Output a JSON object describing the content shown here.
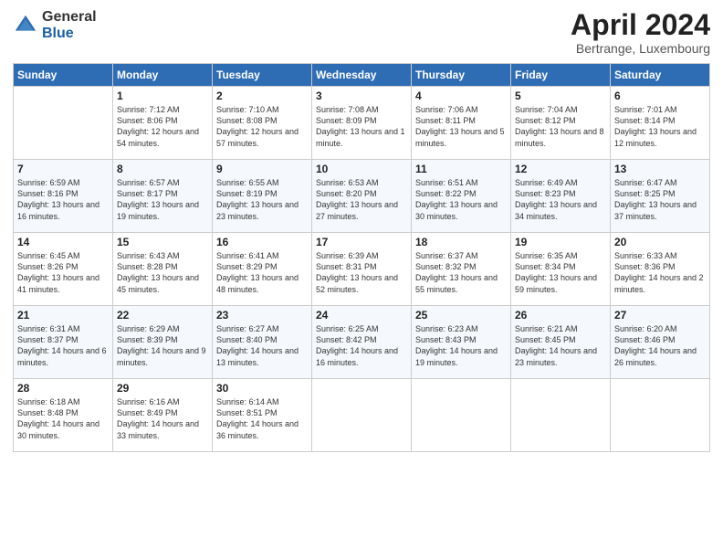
{
  "logo": {
    "general": "General",
    "blue": "Blue"
  },
  "title": "April 2024",
  "location": "Bertrange, Luxembourg",
  "headers": [
    "Sunday",
    "Monday",
    "Tuesday",
    "Wednesday",
    "Thursday",
    "Friday",
    "Saturday"
  ],
  "weeks": [
    [
      {
        "day": "",
        "sunrise": "",
        "sunset": "",
        "daylight": ""
      },
      {
        "day": "1",
        "sunrise": "Sunrise: 7:12 AM",
        "sunset": "Sunset: 8:06 PM",
        "daylight": "Daylight: 12 hours and 54 minutes."
      },
      {
        "day": "2",
        "sunrise": "Sunrise: 7:10 AM",
        "sunset": "Sunset: 8:08 PM",
        "daylight": "Daylight: 12 hours and 57 minutes."
      },
      {
        "day": "3",
        "sunrise": "Sunrise: 7:08 AM",
        "sunset": "Sunset: 8:09 PM",
        "daylight": "Daylight: 13 hours and 1 minute."
      },
      {
        "day": "4",
        "sunrise": "Sunrise: 7:06 AM",
        "sunset": "Sunset: 8:11 PM",
        "daylight": "Daylight: 13 hours and 5 minutes."
      },
      {
        "day": "5",
        "sunrise": "Sunrise: 7:04 AM",
        "sunset": "Sunset: 8:12 PM",
        "daylight": "Daylight: 13 hours and 8 minutes."
      },
      {
        "day": "6",
        "sunrise": "Sunrise: 7:01 AM",
        "sunset": "Sunset: 8:14 PM",
        "daylight": "Daylight: 13 hours and 12 minutes."
      }
    ],
    [
      {
        "day": "7",
        "sunrise": "Sunrise: 6:59 AM",
        "sunset": "Sunset: 8:16 PM",
        "daylight": "Daylight: 13 hours and 16 minutes."
      },
      {
        "day": "8",
        "sunrise": "Sunrise: 6:57 AM",
        "sunset": "Sunset: 8:17 PM",
        "daylight": "Daylight: 13 hours and 19 minutes."
      },
      {
        "day": "9",
        "sunrise": "Sunrise: 6:55 AM",
        "sunset": "Sunset: 8:19 PM",
        "daylight": "Daylight: 13 hours and 23 minutes."
      },
      {
        "day": "10",
        "sunrise": "Sunrise: 6:53 AM",
        "sunset": "Sunset: 8:20 PM",
        "daylight": "Daylight: 13 hours and 27 minutes."
      },
      {
        "day": "11",
        "sunrise": "Sunrise: 6:51 AM",
        "sunset": "Sunset: 8:22 PM",
        "daylight": "Daylight: 13 hours and 30 minutes."
      },
      {
        "day": "12",
        "sunrise": "Sunrise: 6:49 AM",
        "sunset": "Sunset: 8:23 PM",
        "daylight": "Daylight: 13 hours and 34 minutes."
      },
      {
        "day": "13",
        "sunrise": "Sunrise: 6:47 AM",
        "sunset": "Sunset: 8:25 PM",
        "daylight": "Daylight: 13 hours and 37 minutes."
      }
    ],
    [
      {
        "day": "14",
        "sunrise": "Sunrise: 6:45 AM",
        "sunset": "Sunset: 8:26 PM",
        "daylight": "Daylight: 13 hours and 41 minutes."
      },
      {
        "day": "15",
        "sunrise": "Sunrise: 6:43 AM",
        "sunset": "Sunset: 8:28 PM",
        "daylight": "Daylight: 13 hours and 45 minutes."
      },
      {
        "day": "16",
        "sunrise": "Sunrise: 6:41 AM",
        "sunset": "Sunset: 8:29 PM",
        "daylight": "Daylight: 13 hours and 48 minutes."
      },
      {
        "day": "17",
        "sunrise": "Sunrise: 6:39 AM",
        "sunset": "Sunset: 8:31 PM",
        "daylight": "Daylight: 13 hours and 52 minutes."
      },
      {
        "day": "18",
        "sunrise": "Sunrise: 6:37 AM",
        "sunset": "Sunset: 8:32 PM",
        "daylight": "Daylight: 13 hours and 55 minutes."
      },
      {
        "day": "19",
        "sunrise": "Sunrise: 6:35 AM",
        "sunset": "Sunset: 8:34 PM",
        "daylight": "Daylight: 13 hours and 59 minutes."
      },
      {
        "day": "20",
        "sunrise": "Sunrise: 6:33 AM",
        "sunset": "Sunset: 8:36 PM",
        "daylight": "Daylight: 14 hours and 2 minutes."
      }
    ],
    [
      {
        "day": "21",
        "sunrise": "Sunrise: 6:31 AM",
        "sunset": "Sunset: 8:37 PM",
        "daylight": "Daylight: 14 hours and 6 minutes."
      },
      {
        "day": "22",
        "sunrise": "Sunrise: 6:29 AM",
        "sunset": "Sunset: 8:39 PM",
        "daylight": "Daylight: 14 hours and 9 minutes."
      },
      {
        "day": "23",
        "sunrise": "Sunrise: 6:27 AM",
        "sunset": "Sunset: 8:40 PM",
        "daylight": "Daylight: 14 hours and 13 minutes."
      },
      {
        "day": "24",
        "sunrise": "Sunrise: 6:25 AM",
        "sunset": "Sunset: 8:42 PM",
        "daylight": "Daylight: 14 hours and 16 minutes."
      },
      {
        "day": "25",
        "sunrise": "Sunrise: 6:23 AM",
        "sunset": "Sunset: 8:43 PM",
        "daylight": "Daylight: 14 hours and 19 minutes."
      },
      {
        "day": "26",
        "sunrise": "Sunrise: 6:21 AM",
        "sunset": "Sunset: 8:45 PM",
        "daylight": "Daylight: 14 hours and 23 minutes."
      },
      {
        "day": "27",
        "sunrise": "Sunrise: 6:20 AM",
        "sunset": "Sunset: 8:46 PM",
        "daylight": "Daylight: 14 hours and 26 minutes."
      }
    ],
    [
      {
        "day": "28",
        "sunrise": "Sunrise: 6:18 AM",
        "sunset": "Sunset: 8:48 PM",
        "daylight": "Daylight: 14 hours and 30 minutes."
      },
      {
        "day": "29",
        "sunrise": "Sunrise: 6:16 AM",
        "sunset": "Sunset: 8:49 PM",
        "daylight": "Daylight: 14 hours and 33 minutes."
      },
      {
        "day": "30",
        "sunrise": "Sunrise: 6:14 AM",
        "sunset": "Sunset: 8:51 PM",
        "daylight": "Daylight: 14 hours and 36 minutes."
      },
      {
        "day": "",
        "sunrise": "",
        "sunset": "",
        "daylight": ""
      },
      {
        "day": "",
        "sunrise": "",
        "sunset": "",
        "daylight": ""
      },
      {
        "day": "",
        "sunrise": "",
        "sunset": "",
        "daylight": ""
      },
      {
        "day": "",
        "sunrise": "",
        "sunset": "",
        "daylight": ""
      }
    ]
  ]
}
